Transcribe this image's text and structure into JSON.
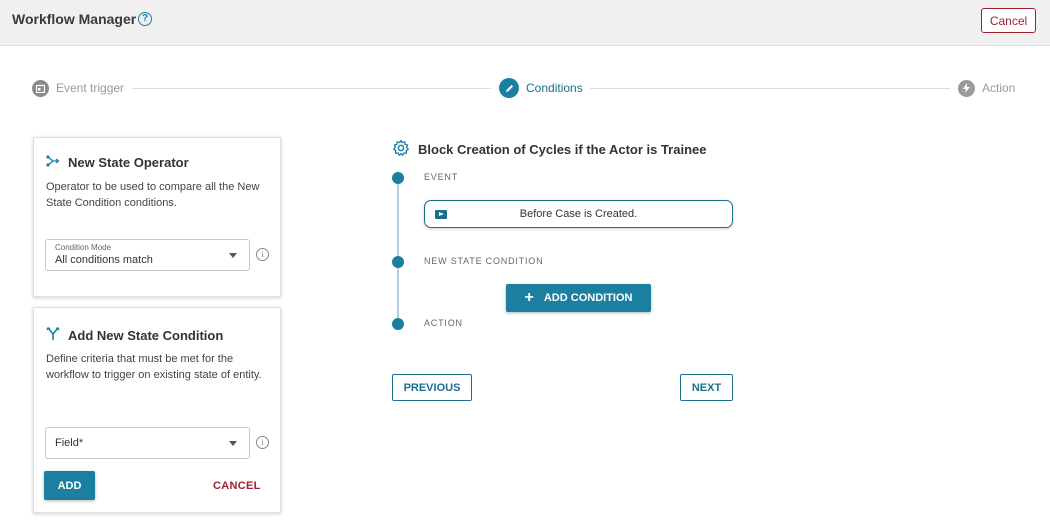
{
  "header": {
    "title": "Workflow Manager",
    "help_icon": "question-circle-icon",
    "cancel_label": "Cancel"
  },
  "stepper": {
    "steps": [
      {
        "label": "Event trigger",
        "icon": "calendar-icon",
        "state": "inactive"
      },
      {
        "label": "Conditions",
        "icon": "pencil-icon",
        "state": "active"
      },
      {
        "label": "Action",
        "icon": "lightning-icon",
        "state": "inactive"
      }
    ]
  },
  "operator_card": {
    "title": "New State Operator",
    "icon": "branch-icon",
    "description": "Operator to be used to compare all the New State Condition conditions.",
    "select_label": "Condition Mode",
    "select_value": "All conditions match"
  },
  "condition_card": {
    "title": "Add New State Condition",
    "icon": "merge-icon",
    "description": "Define criteria that must be met for the workflow to trigger on existing state of entity.",
    "field_placeholder": "Field*",
    "add_label": "ADD",
    "cancel_label": "CANCEL"
  },
  "workflow": {
    "title": "Block Creation of Cycles if the Actor is Trainee",
    "icon": "gear-icon",
    "event_label": "EVENT",
    "event_value": "Before Case is Created.",
    "condition_label": "NEW STATE CONDITION",
    "add_condition_label": "ADD CONDITION",
    "action_label": "ACTION",
    "previous_label": "PREVIOUS",
    "next_label": "NEXT"
  },
  "colors": {
    "accent": "#1b7fa1",
    "danger": "#9b2131",
    "header_bg": "#f0f0f0"
  }
}
